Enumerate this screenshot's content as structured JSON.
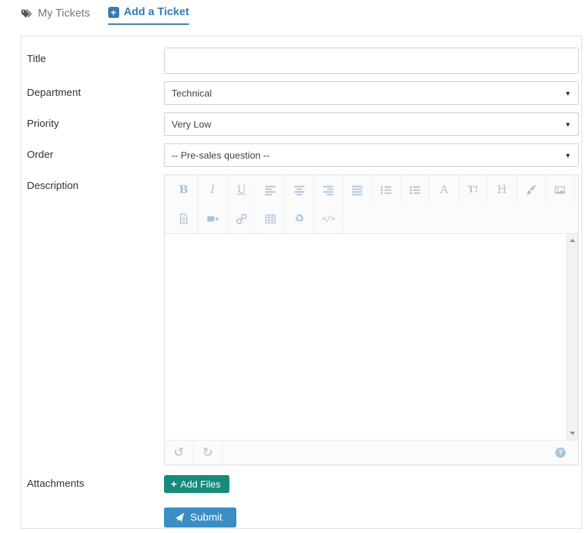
{
  "tabs": {
    "my_tickets_label": "My Tickets",
    "add_ticket_label": "Add a Ticket"
  },
  "icons": {
    "plus": "+",
    "select_arrow": "▾"
  },
  "form": {
    "title": {
      "label": "Title",
      "value": ""
    },
    "department": {
      "label": "Department",
      "value": "Technical"
    },
    "priority": {
      "label": "Priority",
      "value": "Very Low"
    },
    "order": {
      "label": "Order",
      "value": "-- Pre-sales question --"
    },
    "description": {
      "label": "Description",
      "value": ""
    },
    "attachments": {
      "label": "Attachments"
    },
    "add_files_button": "Add Files",
    "submit_button": "Submit"
  },
  "editor": {
    "toolbar_row1": [
      "bold",
      "italic",
      "underline",
      "align-left",
      "align-center",
      "align-right",
      "justify",
      "ordered-list",
      "unordered-list",
      "fore-color",
      "back-color",
      "heading",
      "brush",
      "image"
    ],
    "toolbar_row2": [
      "file",
      "video",
      "link",
      "table",
      "recycle",
      "code"
    ],
    "footer_buttons": [
      "undo",
      "redo"
    ],
    "glyphs": {
      "bold": "B",
      "italic": "I",
      "underline": "U",
      "fore-color": "A",
      "back-color": "T!",
      "heading": "H",
      "recycle": "♻",
      "code": "</>",
      "undo": "↺",
      "redo": "↻",
      "help": "?"
    }
  },
  "colors": {
    "accent_blue": "#337ab7",
    "submit_blue": "#3b8dc3",
    "add_files_teal": "#178a7e",
    "toolbar_icon_blue": "#a9c4da"
  }
}
